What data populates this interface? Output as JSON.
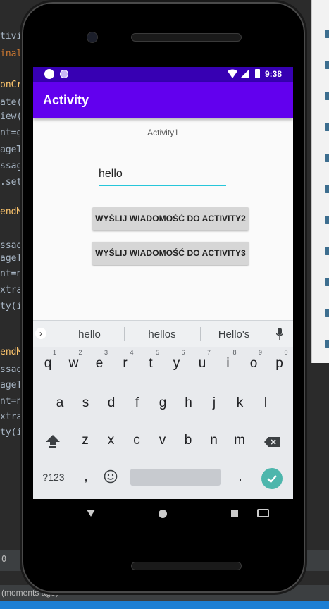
{
  "ide": {
    "code_lines": [
      {
        "text": "tivi",
        "color": "#a9b7c6"
      },
      {
        "text": "inal",
        "color": "#cc7832"
      },
      {
        "text": "onCr",
        "color": "#ffc66d"
      },
      {
        "text": "ate(",
        "color": "#a9b7c6"
      },
      {
        "text": "iew(",
        "color": "#a9b7c6"
      },
      {
        "text": "nt=g",
        "color": "#a9b7c6"
      },
      {
        "text": "ageT",
        "color": "#a9b7c6"
      },
      {
        "text": "ssag",
        "color": "#a9b7c6"
      },
      {
        "text": ".set",
        "color": "#a9b7c6"
      },
      {
        "text": "endM",
        "color": "#ffc66d"
      },
      {
        "text": "ssag",
        "color": "#a9b7c6"
      },
      {
        "text": "ageT",
        "color": "#a9b7c6"
      },
      {
        "text": "nt=n",
        "color": "#a9b7c6"
      },
      {
        "text": "xtra",
        "color": "#a9b7c6"
      },
      {
        "text": "ty(i",
        "color": "#a9b7c6"
      },
      {
        "text": "endM",
        "color": "#ffc66d"
      },
      {
        "text": "ssag",
        "color": "#a9b7c6"
      },
      {
        "text": "ageT",
        "color": "#a9b7c6"
      },
      {
        "text": "nt=n",
        "color": "#a9b7c6"
      },
      {
        "text": "xtra",
        "color": "#a9b7c6"
      },
      {
        "text": "ty(i",
        "color": "#a9b7c6"
      }
    ],
    "status_text": "0",
    "bottom_text": "(moments ago)"
  },
  "device": {
    "status_time": "9:38"
  },
  "app": {
    "title": "Activity",
    "label": "Activity1",
    "input_value": "hello",
    "button1_label": "WYŚLIJ WIADOMOŚĆ DO ACTIVITY2",
    "button2_label": "WYŚLIJ WIADOMOŚĆ DO ACTIVITY3",
    "accent_color": "#6200ee",
    "status_color": "#3700b3"
  },
  "keyboard": {
    "suggestions": [
      "hello",
      "hellos",
      "Hello's"
    ],
    "row1": [
      {
        "k": "q",
        "n": "1"
      },
      {
        "k": "w",
        "n": "2"
      },
      {
        "k": "e",
        "n": "3"
      },
      {
        "k": "r",
        "n": "4"
      },
      {
        "k": "t",
        "n": "5"
      },
      {
        "k": "y",
        "n": "6"
      },
      {
        "k": "u",
        "n": "7"
      },
      {
        "k": "i",
        "n": "8"
      },
      {
        "k": "o",
        "n": "9"
      },
      {
        "k": "p",
        "n": "0"
      }
    ],
    "row2": [
      "a",
      "s",
      "d",
      "f",
      "g",
      "h",
      "j",
      "k",
      "l"
    ],
    "row3": [
      "z",
      "x",
      "c",
      "v",
      "b",
      "n",
      "m"
    ],
    "symbols_label": "?123",
    "comma": ",",
    "period": "."
  }
}
